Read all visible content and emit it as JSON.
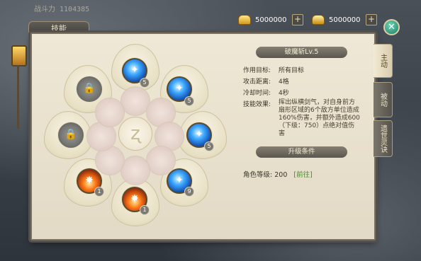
{
  "header": {
    "top_text": "战斗力 1104385"
  },
  "currency": [
    {
      "value": "5000000",
      "icon": "gold-ingot-icon"
    },
    {
      "value": "5000000",
      "icon": "bound-ingot-icon"
    }
  ],
  "panel": {
    "title": "技能"
  },
  "skill": {
    "name": "破魔斩Lv.5",
    "target_label": "作用目标:",
    "target_value": "所有目标",
    "range_label": "攻击距离:",
    "range_value": "4格",
    "cooldown_label": "冷却时间:",
    "cooldown_value": "4秒",
    "effect_label": "技能效果:",
    "effect_value": "挥出纵横剑气，对自身前方扇形区域的6个敌方单位造成160%伤害，并额外造成600（下级：750）点绝对值伤害"
  },
  "upgrade": {
    "title": "升级条件",
    "level_label": "角色等级:",
    "level_value": "200",
    "goto_label": "[前往]"
  },
  "skills": [
    {
      "id": "top",
      "level": "5",
      "type": "blue"
    },
    {
      "id": "upper-right",
      "level": "5",
      "type": "blue"
    },
    {
      "id": "right",
      "level": "5",
      "type": "blue"
    },
    {
      "id": "lower-right",
      "level": "9",
      "type": "blue"
    },
    {
      "id": "bottom",
      "level": "1",
      "type": "fire"
    },
    {
      "id": "lower-left",
      "level": "1",
      "type": "fire"
    },
    {
      "id": "left",
      "level": "",
      "type": "locked"
    },
    {
      "id": "upper-left",
      "level": "",
      "type": "locked"
    }
  ],
  "side_tabs": [
    {
      "label": "主动",
      "active": true
    },
    {
      "label": "被动",
      "active": false
    },
    {
      "label": "遗世灵诀",
      "active": false
    }
  ]
}
